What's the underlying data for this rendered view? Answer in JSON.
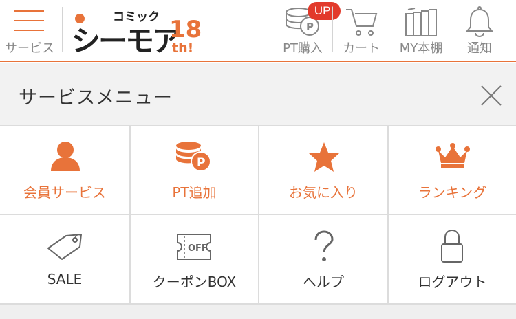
{
  "header": {
    "menu_label": "サービス",
    "logo": {
      "small_text": "コミック",
      "main_text": "シーモア",
      "anniv_number": "18",
      "anniv_suffix": "th!"
    },
    "pt_purchase_label": "PT購入",
    "up_badge": "UP!",
    "cart_label": "カート",
    "bookshelf_label": "MY本棚",
    "notice_label": "通知"
  },
  "menu": {
    "title": "サービスメニュー"
  },
  "grid": {
    "items": [
      {
        "label": "会員サービス",
        "icon": "person-icon"
      },
      {
        "label": "PT追加",
        "icon": "coins-p-icon"
      },
      {
        "label": "お気に入り",
        "icon": "star-icon"
      },
      {
        "label": "ランキング",
        "icon": "crown-icon"
      },
      {
        "label": "SALE",
        "icon": "tag-icon"
      },
      {
        "label": "クーポンBOX",
        "icon": "coupon-icon"
      },
      {
        "label": "ヘルプ",
        "icon": "question-icon"
      },
      {
        "label": "ログアウト",
        "icon": "lock-icon"
      }
    ]
  },
  "colors": {
    "accent": "#e8733a",
    "badge": "#e23a2b",
    "logo_dark": "#222222"
  }
}
